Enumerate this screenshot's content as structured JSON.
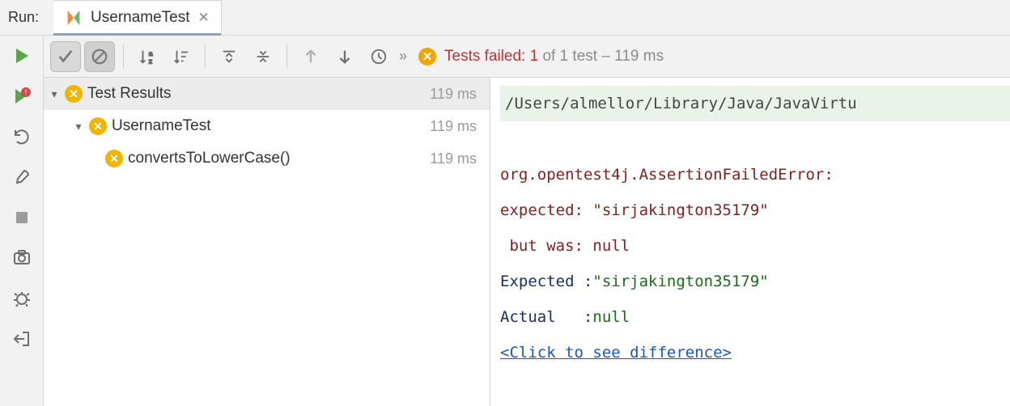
{
  "header": {
    "run_label": "Run:",
    "tab_title": "UsernameTest"
  },
  "status": {
    "fail_text": "Tests failed: 1",
    "of_text": " of 1 test – 119 ms"
  },
  "tree": {
    "root": {
      "label": "Test Results",
      "duration": "119 ms"
    },
    "class": {
      "label": "UsernameTest",
      "duration": "119 ms"
    },
    "method": {
      "label": "convertsToLowerCase()",
      "duration": "119 ms"
    }
  },
  "output": {
    "cmd": "/Users/almellor/Library/Java/JavaVirtu",
    "err1": "org.opentest4j.AssertionFailedError: ",
    "err2": "expected: \"sirjakington35179\"",
    "err3": " but was: null",
    "exp_k": "Expected :",
    "exp_v": "\"sirjakington35179\"",
    "act_k": "Actual   :",
    "act_v": "null",
    "link": "<Click to see difference>"
  }
}
